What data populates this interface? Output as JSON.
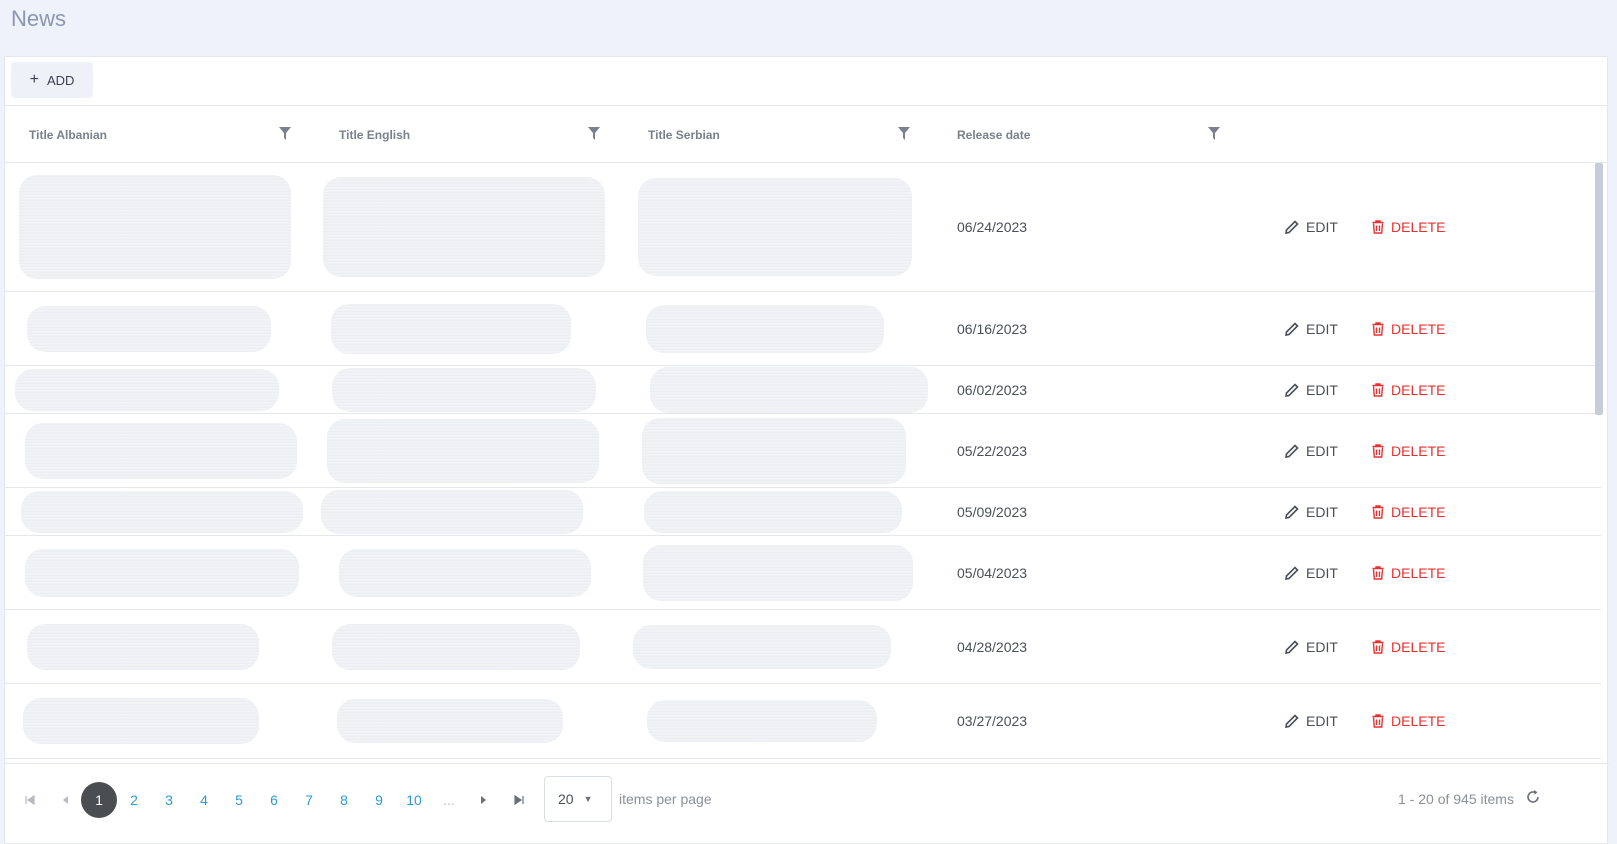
{
  "page": {
    "title": "News"
  },
  "toolbar": {
    "add_label": "ADD"
  },
  "columns": {
    "title_albanian": "Title Albanian",
    "title_english": "Title English",
    "title_serbian": "Title Serbian",
    "release_date": "Release date"
  },
  "rows": [
    {
      "date": "06/24/2023",
      "edit": "EDIT",
      "delete": "DELETE"
    },
    {
      "date": "06/16/2023",
      "edit": "EDIT",
      "delete": "DELETE"
    },
    {
      "date": "06/02/2023",
      "edit": "EDIT",
      "delete": "DELETE"
    },
    {
      "date": "05/22/2023",
      "edit": "EDIT",
      "delete": "DELETE"
    },
    {
      "date": "05/09/2023",
      "edit": "EDIT",
      "delete": "DELETE"
    },
    {
      "date": "05/04/2023",
      "edit": "EDIT",
      "delete": "DELETE"
    },
    {
      "date": "04/28/2023",
      "edit": "EDIT",
      "delete": "DELETE"
    },
    {
      "date": "03/27/2023",
      "edit": "EDIT",
      "delete": "DELETE"
    }
  ],
  "pager": {
    "pages": [
      "1",
      "2",
      "3",
      "4",
      "5",
      "6",
      "7",
      "8",
      "9",
      "10",
      "..."
    ],
    "current": "1",
    "page_size": "20",
    "per_page_label": "items per page",
    "info": "1 - 20 of 945 items"
  },
  "icons": {
    "add": "plus-icon",
    "filter": "filter-icon",
    "edit": "pencil-icon",
    "delete": "trash-icon",
    "first": "first-page-icon",
    "prev": "prev-page-icon",
    "next": "next-page-icon",
    "last": "last-page-icon",
    "refresh": "refresh-icon"
  },
  "colors": {
    "background": "#eef2fb",
    "title": "#8c96b0",
    "delete": "#e8302f",
    "page_link": "#2d9bd3",
    "page_active": "#4a4d52"
  }
}
